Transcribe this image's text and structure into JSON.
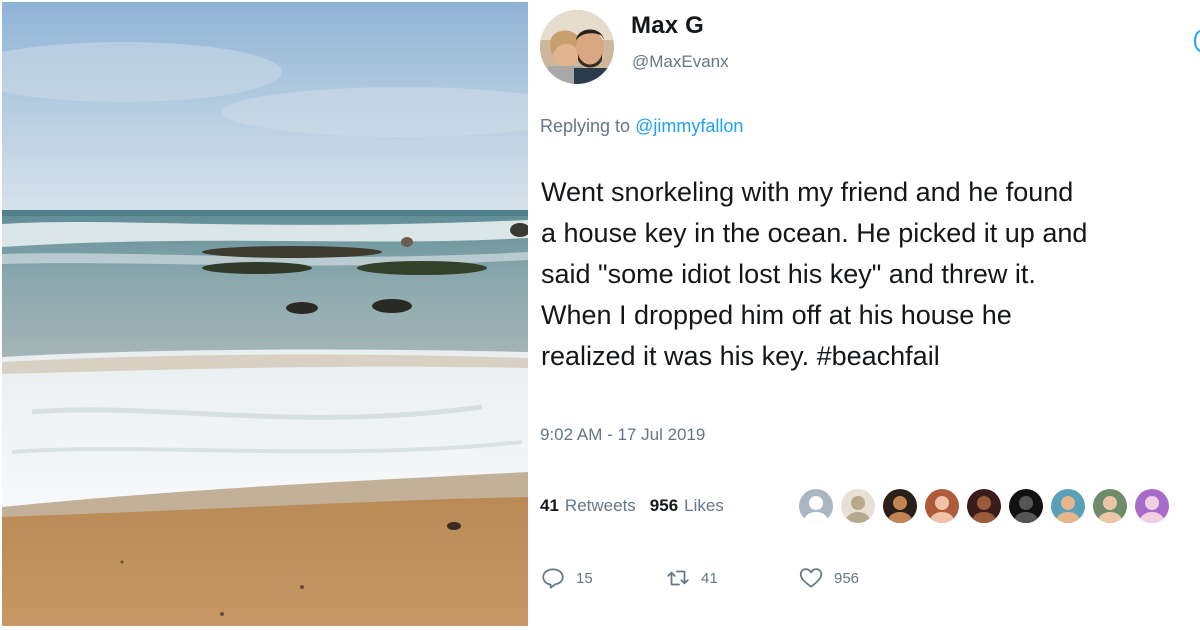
{
  "tweet": {
    "display_name": "Max G",
    "handle": "@MaxEvanx",
    "replying_prefix": "Replying to",
    "replying_mention": "@jimmyfallon",
    "text": "Went snorkeling with my friend and he found\na house key in the ocean. He picked it up and\n said \"some idiot lost his key\" and threw it.\nWhen I dropped him off at his house he\nrealized it was his key. #beachfail",
    "timestamp": "9:02 AM - 17 Jul 2019"
  },
  "stats": {
    "retweets_count": "41",
    "retweets_label": "Retweets",
    "likes_count": "956",
    "likes_label": "Likes"
  },
  "actions": {
    "reply_count": "15",
    "retweet_count": "41",
    "like_count": "956"
  },
  "likers": [
    {
      "name": "liker-default",
      "bg": "#a9b7c4",
      "face": "#ffffff"
    },
    {
      "name": "liker-2",
      "bg": "#e6e1d4",
      "face": "#b9a98c"
    },
    {
      "name": "liker-3",
      "bg": "#2a1f1a",
      "face": "#c08552"
    },
    {
      "name": "liker-4",
      "bg": "#b05a3c",
      "face": "#f0c3a6"
    },
    {
      "name": "liker-5",
      "bg": "#3a1c1c",
      "face": "#9a5b3a"
    },
    {
      "name": "liker-6",
      "bg": "#111111",
      "face": "#555555"
    },
    {
      "name": "liker-7",
      "bg": "#5aa0b8",
      "face": "#e8b48c"
    },
    {
      "name": "liker-8",
      "bg": "#6f8c6a",
      "face": "#ecc6a4"
    },
    {
      "name": "liker-9",
      "bg": "#a56bc7",
      "face": "#f3cfe6"
    }
  ],
  "colors": {
    "text": "#14171a",
    "muted": "#657786",
    "accent": "#1da1f2"
  },
  "icons": {
    "reply": "reply-icon",
    "retweet": "retweet-icon",
    "like": "heart-icon"
  }
}
